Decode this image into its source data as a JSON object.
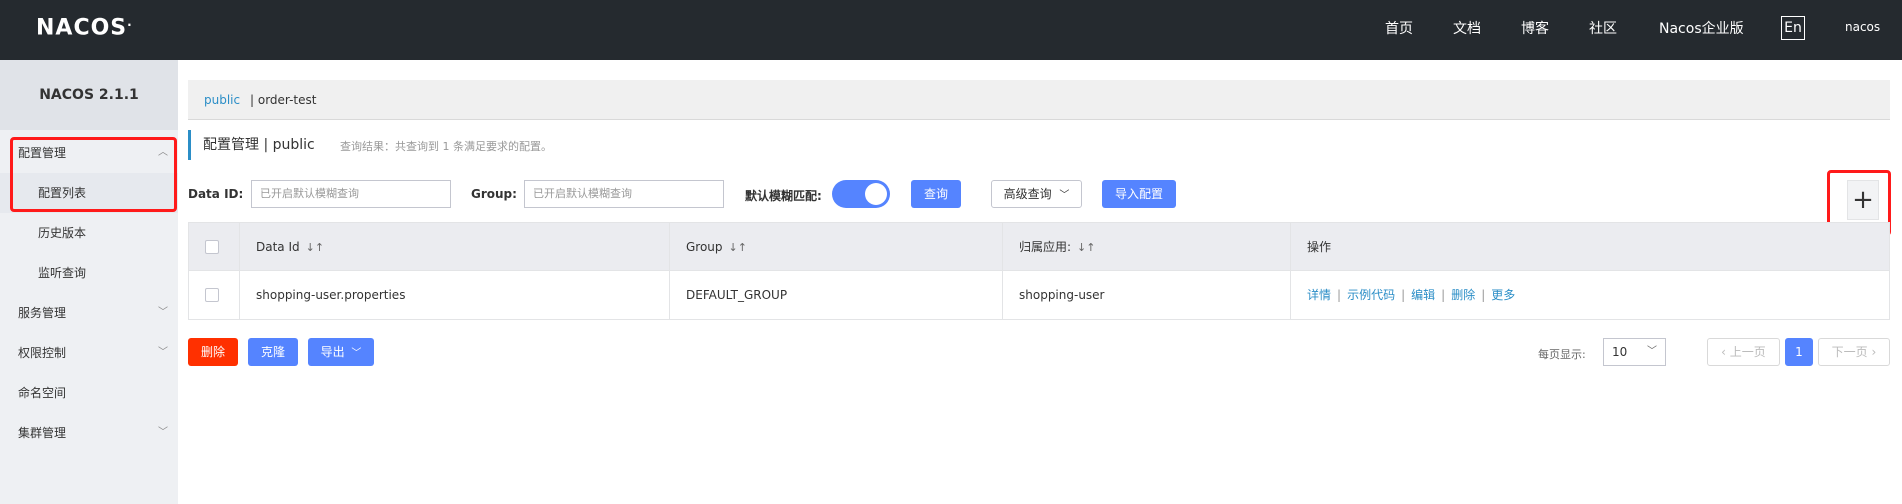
{
  "header": {
    "logo": "NACOS",
    "nav": [
      "首页",
      "文档",
      "博客",
      "社区",
      "Nacos企业版"
    ],
    "lang_button": "En",
    "user": "nacos"
  },
  "sidebar": {
    "version": "NACOS 2.1.1",
    "items": [
      {
        "label": "配置管理"
      },
      {
        "label": "配置列表"
      },
      {
        "label": "历史版本"
      },
      {
        "label": "监听查询"
      },
      {
        "label": "服务管理"
      },
      {
        "label": "权限控制"
      },
      {
        "label": "命名空间"
      },
      {
        "label": "集群管理"
      }
    ]
  },
  "breadcrumb": {
    "active": "public",
    "other": "| order-test"
  },
  "title": {
    "text": "配置管理  |  public",
    "result": "查询结果：共查询到 1 条满足要求的配置。"
  },
  "search": {
    "data_id_label": "Data ID:",
    "data_id_placeholder": "已开启默认模糊查询",
    "group_label": "Group:",
    "group_placeholder": "已开启默认模糊查询",
    "fuzzy_label": "默认模糊匹配:",
    "fuzzy_enabled": true,
    "query_button": "查询",
    "advanced_button": "高级查询",
    "import_button": "导入配置",
    "add_button": "+"
  },
  "table": {
    "columns": [
      "Data Id",
      "Group",
      "归属应用:",
      "操作"
    ],
    "rows": [
      {
        "data_id": "shopping-user.properties",
        "group": "DEFAULT_GROUP",
        "app": "shopping-user",
        "ops": [
          "详情",
          "示例代码",
          "编辑",
          "删除",
          "更多"
        ]
      }
    ]
  },
  "actions": {
    "delete": "删除",
    "clone": "克隆",
    "export": "导出"
  },
  "pager": {
    "per_page_label": "每页显示:",
    "per_page": "10",
    "prev": "上一页",
    "current": "1",
    "next": "下一页"
  },
  "colors": {
    "topbar": "#252a2f",
    "primary": "#5584ff",
    "link": "#2b8ec7",
    "danger": "#ff3000",
    "highlight": "#ff1a1a"
  }
}
